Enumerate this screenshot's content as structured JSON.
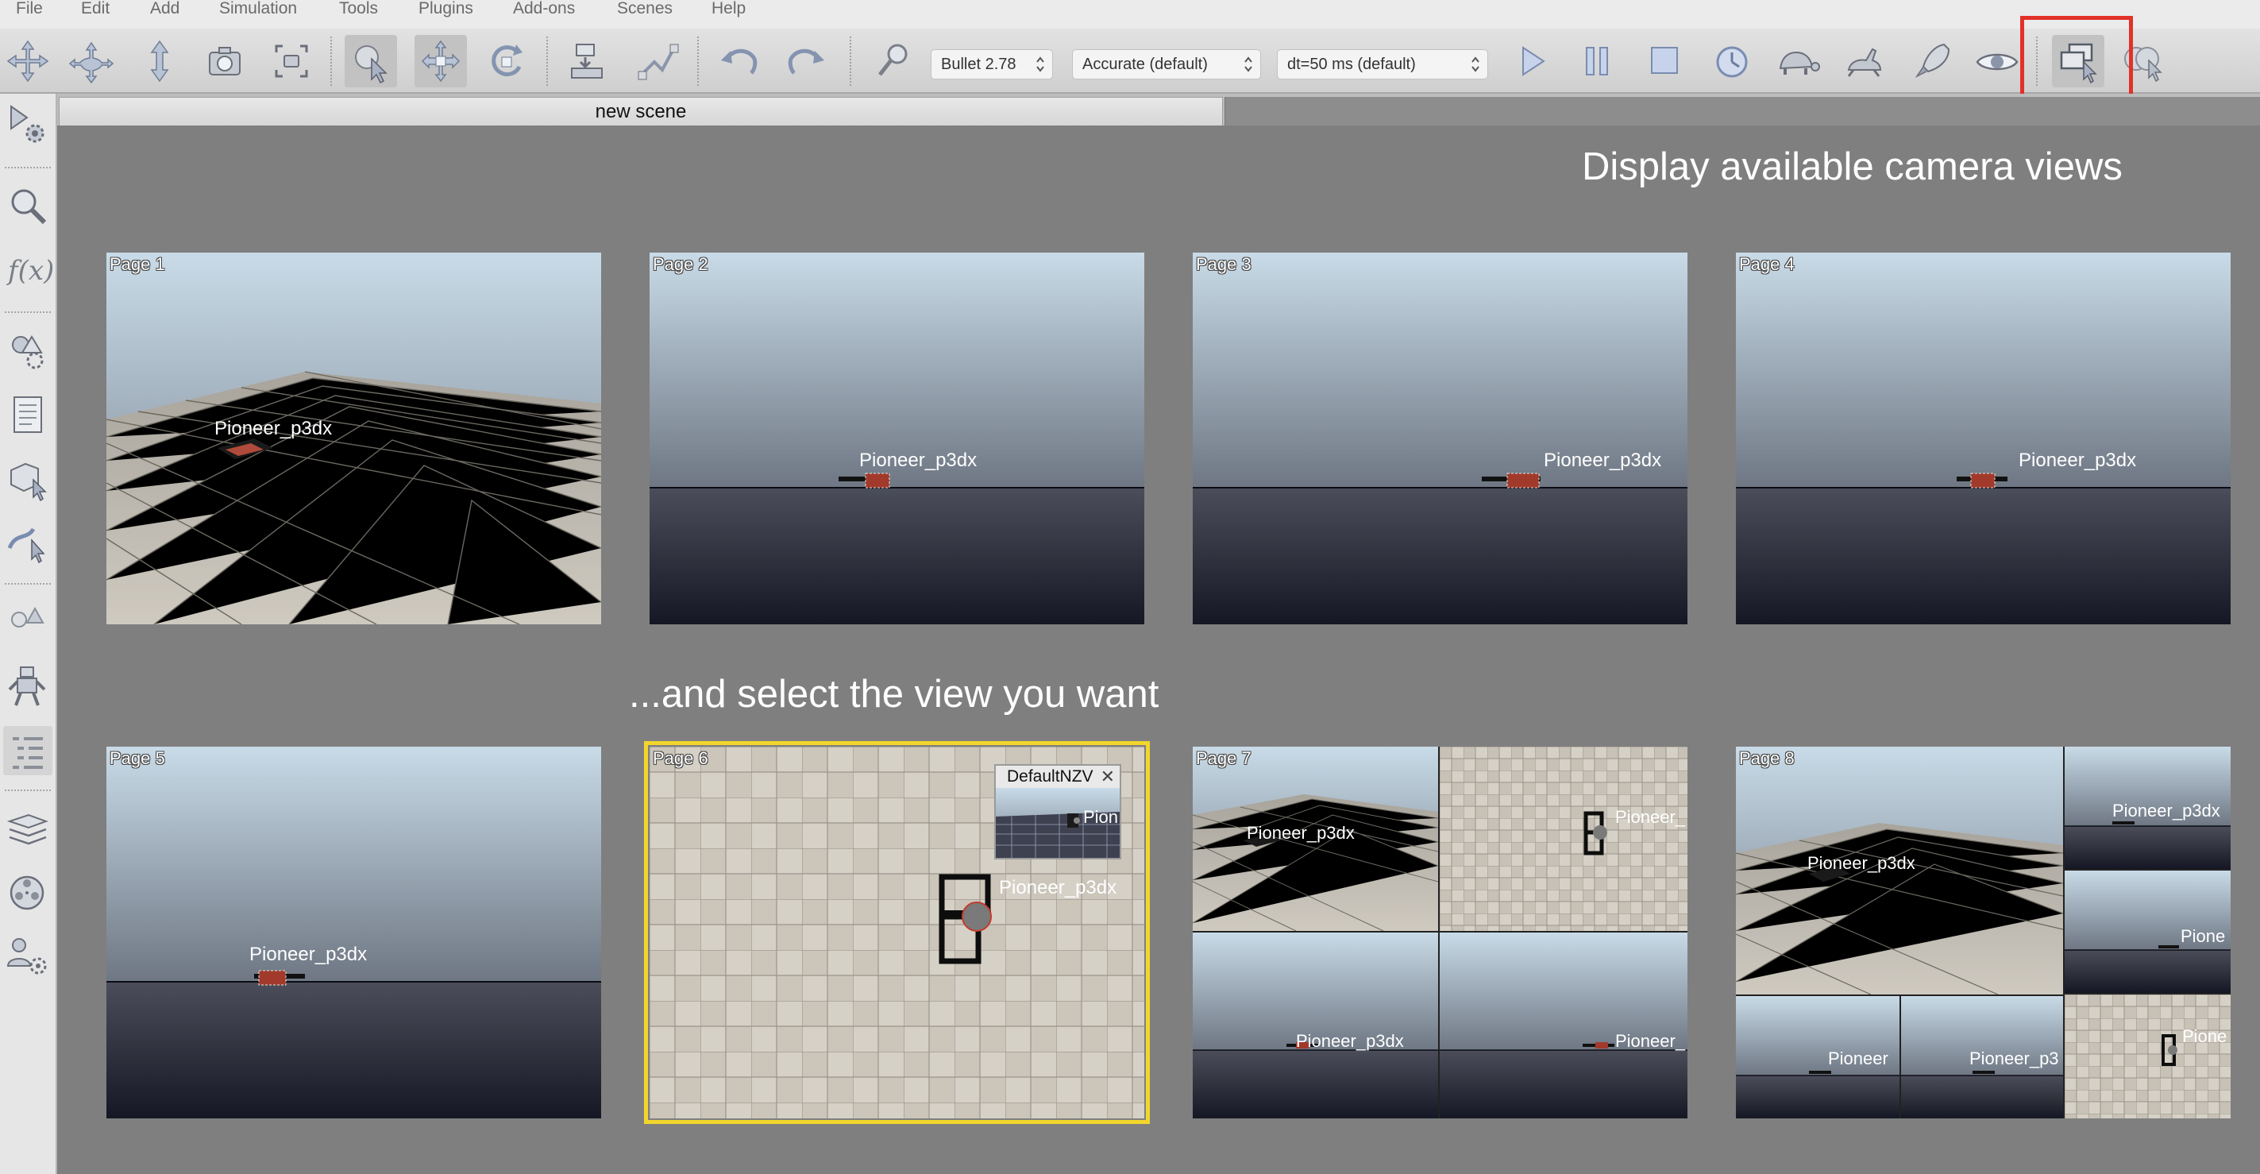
{
  "menu": [
    "File",
    "Edit",
    "Add",
    "Simulation",
    "Tools",
    "Plugins",
    "Add-ons",
    "Scenes",
    "Help"
  ],
  "toolbar": {
    "engine": "Bullet 2.78",
    "accuracy": "Accurate (default)",
    "timestep": "dt=50 ms (default)",
    "highlight_color": "#e23127"
  },
  "tab": {
    "title": "new scene"
  },
  "captions": {
    "top": "Display available camera views",
    "middle": "...and select the view you want"
  },
  "pages": [
    {
      "label": "Page 1",
      "robot": "Pioneer_p3dx"
    },
    {
      "label": "Page 2",
      "robot": "Pioneer_p3dx"
    },
    {
      "label": "Page 3",
      "robot": "Pioneer_p3dx"
    },
    {
      "label": "Page 4",
      "robot": "Pioneer_p3dx"
    },
    {
      "label": "Page 5",
      "robot": "Pioneer_p3dx"
    },
    {
      "label": "Page 6",
      "robot": "Pioneer_p3dx",
      "selected": true,
      "inset_title": "DefaultNZV",
      "inset_robot": "Pion"
    },
    {
      "label": "Page 7",
      "robots": [
        "Pioneer_p3dx",
        "Pioneer_",
        "Pioneer_p3dx",
        "Pioneer_"
      ]
    },
    {
      "label": "Page 8",
      "robots": [
        "Pioneer_p3dx",
        "Pioneer_p3dx",
        "Pione",
        "Pioneer",
        "Pioneer_p3",
        "Pione"
      ]
    }
  ],
  "colors": {
    "selected_outline": "#f2d62b",
    "sky_top": "#c9dbe8",
    "ground": "#1c1d2b"
  }
}
